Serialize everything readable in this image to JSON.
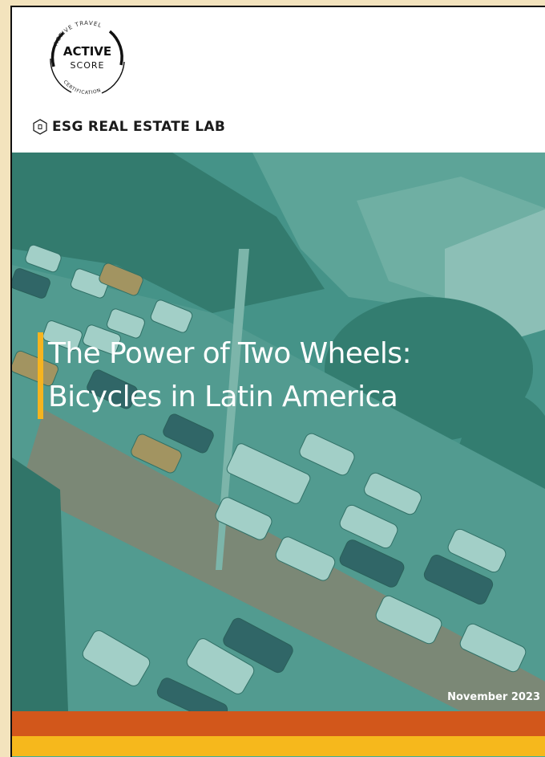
{
  "seal": {
    "arc_top": "ACTIVE TRAVEL",
    "line1": "ACTIVE",
    "line2": "SCORE",
    "arc_bottom": "CERTIFICATION"
  },
  "brand": {
    "name": "ESG REAL ESTATE LAB",
    "icon": "hexagon-logo-icon"
  },
  "cover": {
    "title_line1": "The Power of Two Wheels:",
    "title_line2": "Bicycles in Latin America",
    "date": "November 2023"
  },
  "colors": {
    "page_background": "#f3e3bd",
    "teal_overlay": "#3d9a8c",
    "title_bar": "#f5b41f",
    "stripe_orange": "#d2571b",
    "stripe_yellow": "#f6b81c",
    "stripe_teal": "#3fae97"
  }
}
